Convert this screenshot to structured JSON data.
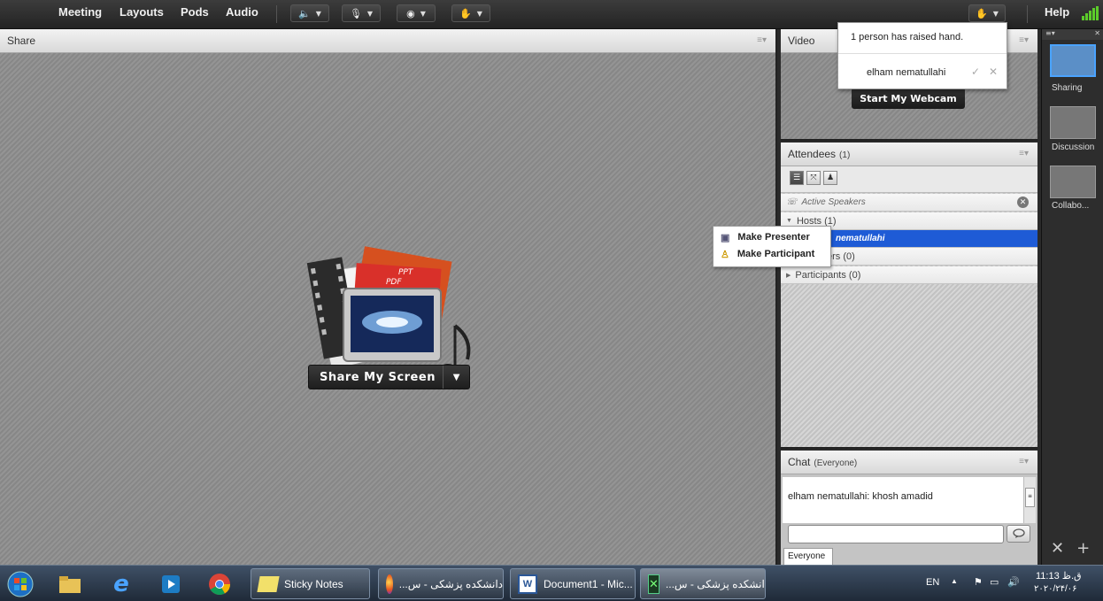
{
  "menubar": {
    "items": [
      "Meeting",
      "Layouts",
      "Pods",
      "Audio"
    ],
    "help": "Help"
  },
  "share_pod": {
    "title": "Share",
    "share_button": "Share My Screen",
    "graphic_labels": [
      "PPT",
      "PDF"
    ]
  },
  "video_pod": {
    "title": "Video",
    "webcam_button": "Start My Webcam"
  },
  "notification": {
    "message": "1 person has raised hand.",
    "person": "elham nematullahi"
  },
  "attendees_pod": {
    "title": "Attendees",
    "count": "(1)",
    "active_speakers": "Active Speakers",
    "hosts": "Hosts (1)",
    "host_name": "nematullahi",
    "presenters": "ers (0)",
    "participants": "Participants (0)"
  },
  "context_menu": {
    "items": [
      "Make Presenter",
      "Make Participant"
    ]
  },
  "chat_pod": {
    "title": "Chat",
    "scope": "(Everyone)",
    "message_sender": "elham nematullahi:",
    "message_text": " khosh amadid",
    "input_value": "",
    "tab": "Everyone"
  },
  "layouts": {
    "items": [
      "Sharing",
      "Discussion",
      "Collabo..."
    ],
    "selected": "Sharing"
  },
  "taskbar": {
    "tasks": [
      "Sticky Notes",
      "...دانشکده پزشکی - س",
      "Document1 - Mic...",
      "...دانشکده پزشکی - س"
    ],
    "lang": "EN",
    "time": "11:13 ق.ظ",
    "date": "۲۰۲۰/۲۴/۰۶"
  },
  "colors": {
    "selection": "#1e5bd6",
    "layout_highlight": "#4aa3ff",
    "taskbar": "#2a3646"
  }
}
